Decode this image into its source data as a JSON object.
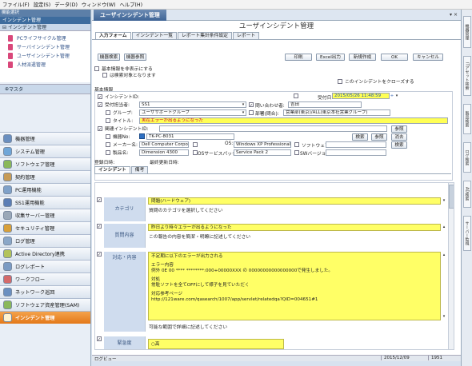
{
  "menu": [
    "ファイル(F)",
    "設定(S)",
    "データ(D)",
    "ウィンドウ(W)",
    "ヘルプ(H)"
  ],
  "left": {
    "top_label": "機能選択",
    "header": "インシデント管理",
    "sub": "インシデント管理",
    "items": [
      "PCライフサイクル管理",
      "サーバインシデント管理",
      "ユーザインシデント管理",
      "人材派遣管理"
    ],
    "master": "マスタ",
    "nav": [
      "機器管理",
      "システム管理",
      "ソフトウェア管理",
      "契約管理",
      "PC運用機能",
      "SS1運用機能",
      "収集サーバー管理",
      "セキュリティ管理",
      "ログ管理",
      "Active Directory連携",
      "ログレポート",
      "ワークフロー",
      "ネットワーク巡回",
      "ソフトウェア資産管理(SAM)",
      "インシデント管理"
    ]
  },
  "main": {
    "window_tab": "ユーザインシデント管理",
    "win_ctl": "▾ ×",
    "form_title": "ユーザインシデント管理",
    "tabs": [
      "入力フォーム",
      "インシデント一覧",
      "レポート集計条件設定",
      "レポート"
    ],
    "buttons_left": [
      "機器検索",
      "機器参照"
    ],
    "buttons_right": [
      "印刷",
      "Excel出力",
      "新規作成",
      "OK",
      "キャンセル"
    ],
    "opt1": "基本情報を非表示にする",
    "opt2": "は検索対象となります",
    "close_opt": "このインシデントをクローズする",
    "basic_info": "基本情報",
    "incident_id_label": "インシデントID:",
    "received_label": "受付日:",
    "received_value": "2015/05/26 11:48:59",
    "receiver_label": "受付担当者:",
    "receiver_value": "SS1",
    "inquirer_label": "問い合わせ者:",
    "inquirer_value": "吉田",
    "group_label": "グループ:",
    "group_value": "ユーザサポートグループ",
    "dept_label": "部署(問合):",
    "dept_value": "営業部(東京)/ALL(東京本社営業グループ)",
    "title_label": "タイトル:",
    "title_value": "実在エラーが出るようになった",
    "related_label": "関連インシデントID:",
    "ref_button": "参照",
    "machine_label": "機器No:",
    "machine_value": "TK-PC-8031",
    "search_button": "検索",
    "ref_button2": "参照",
    "clear_button": "消去",
    "maker_label": "メーカー名:",
    "maker_value": "Dell Computer Corpo",
    "os_label": "OS:",
    "os_value": "Windows XP Professional",
    "software_label": "ソフトウェア:",
    "search_button2": "検索",
    "product_label": "製品名:",
    "product_value": "Dimension 4300",
    "ospack_label": "OSサービスパック:",
    "ospack_value": "Service Pack 2",
    "swver_label": "SWバージョン:",
    "reg_date_label": "登録日時:",
    "upd_date_label": "最終更新日時:",
    "subtabs": [
      "インシデント",
      "備考"
    ],
    "sections": [
      {
        "label": "カテゴリ",
        "value": "問題(ハードウェア)",
        "hint": "質問のカテゴリを選択してください"
      },
      {
        "label": "質問内容",
        "value": "昨日より時々エラーが出るようになった",
        "hint": "この報告の内容を簡潔・明瞭に記述してください"
      },
      {
        "label": "対応・内容",
        "lines": [
          "不定期に以下のエラーが出力される",
          "",
          "エラー内容",
          "例外 0E 00 **** ********:000+00000XXX の 00000000000000000で発生しました。",
          "",
          "対処",
          "常駐ソフトを全てOFFにして様子を見ていただく",
          "",
          "対応参考ページ",
          "http://121ware.com/qasearch/1007/app/servlet/relatedqa?QID=004651#1"
        ],
        "hint": "可能な範囲で詳細に記述してください"
      },
      {
        "label": "緊急度",
        "value": "○高"
      }
    ]
  },
  "status": {
    "log": "ログビュー",
    "date": "2015/12/09",
    "time": "1951"
  },
  "right_tabs": [
    "機器管理",
    "ITアセット検索",
    "製品検索",
    "ログ検索",
    "AD検索",
    "サーバー監視"
  ]
}
